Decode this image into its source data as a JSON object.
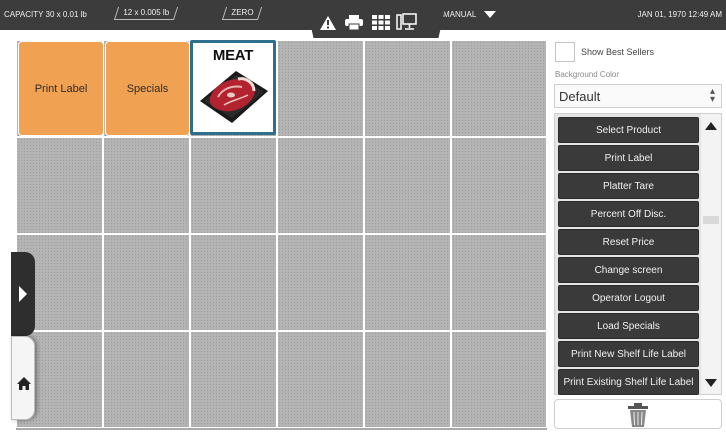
{
  "status_bar": {
    "capacity": "CAPACITY   30 x 0.01 lb",
    "increment": "12 x 0.005 lb",
    "zero": "ZERO",
    "mode": "MANUAL",
    "datetime": "JAN 01, 1970 12:49 AM",
    "icons": [
      "warning-icon",
      "printer-icon",
      "grid-icon",
      "station-icon"
    ]
  },
  "grid": {
    "tiles": [
      {
        "label": "Print Label",
        "color": "#f0a252"
      },
      {
        "label": "Specials",
        "color": "#f0a252"
      }
    ],
    "product_tile": {
      "title": "MEAT",
      "image": "raw-steak-on-tray"
    },
    "columns": 6,
    "rows": 4
  },
  "sidebar": {
    "show_best_sellers": {
      "label": "Show Best Sellers",
      "checked": false
    },
    "background_color": {
      "label": "Background Color",
      "value": "Default"
    },
    "buttons": [
      "Select Product",
      "Print Label",
      "Platter Tare",
      "Percent Off Disc.",
      "Reset Price",
      "Change screen",
      "Operator Logout",
      "Load Specials",
      "Print New Shelf Life Label",
      "Print Existing Shelf Life Label"
    ]
  },
  "icons": {
    "expand": "chevron-right-icon",
    "home": "home-icon",
    "trash": "trash-icon",
    "scroll_up": "arrow-up-icon",
    "scroll_down": "arrow-down-icon"
  },
  "colors": {
    "topbar": "#3c3c3c",
    "tile_orange": "#f0a252",
    "function_button": "#3a3a3a",
    "selected_border": "#2e6f8e"
  }
}
